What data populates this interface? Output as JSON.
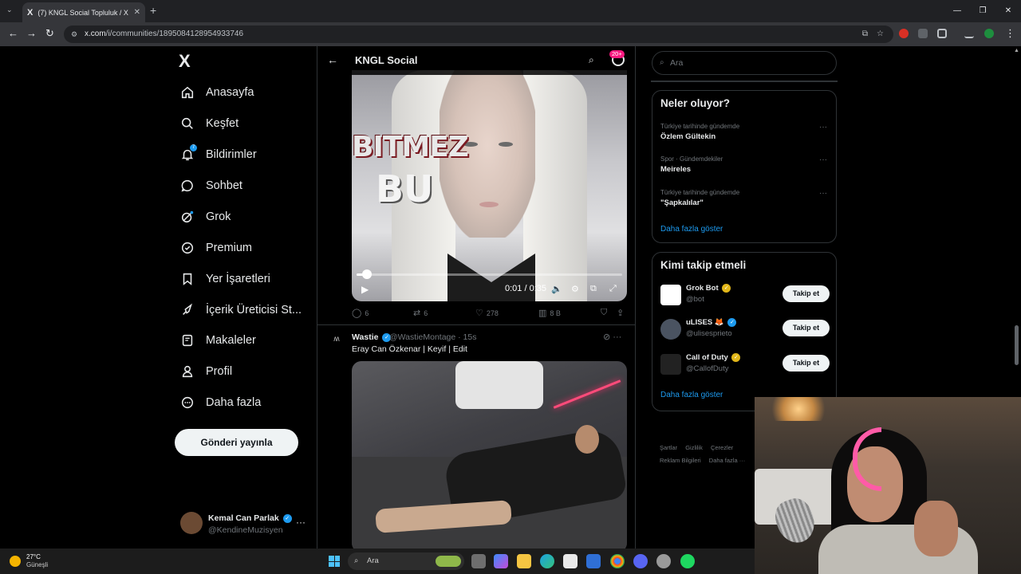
{
  "browser": {
    "tab_title": "(7) KNGL Social Topluluk / X",
    "tab_icon": "X",
    "url_host": "x.com",
    "url_path": "/i/communities/1895084128954933746"
  },
  "sidebar": {
    "logo": "X",
    "items": [
      {
        "label": "Anasayfa",
        "icon": "home-icon"
      },
      {
        "label": "Keşfet",
        "icon": "search-icon"
      },
      {
        "label": "Bildirimler",
        "icon": "bell-icon",
        "badge": "7"
      },
      {
        "label": "Sohbet",
        "icon": "chat-icon"
      },
      {
        "label": "Grok",
        "icon": "grok-icon"
      },
      {
        "label": "Premium",
        "icon": "verified-icon"
      },
      {
        "label": "Yer İşaretleri",
        "icon": "bookmark-icon"
      },
      {
        "label": "İçerik Üreticisi St...",
        "icon": "rocket-icon"
      },
      {
        "label": "Makaleler",
        "icon": "articles-icon"
      },
      {
        "label": "Profil",
        "icon": "person-icon"
      },
      {
        "label": "Daha fazla",
        "icon": "more-circle-icon"
      }
    ],
    "post_button": "Gönderi yayınla",
    "profile": {
      "name": "Kemal Can Parlak",
      "handle": "@KendineMuzisyen"
    }
  },
  "center": {
    "header_title": "KNGL Social",
    "notif_badge": "20+",
    "video1": {
      "overlay_text_1": "BITMEZ",
      "overlay_text_2": "BU",
      "time": "0:01 / 0:35",
      "progress": 0.03
    },
    "tweet1_actions": {
      "replies": "6",
      "reposts": "6",
      "likes": "278",
      "views": "8 B"
    },
    "tweet2": {
      "name": "Wastie",
      "handle": "@WastieMontage · 15s",
      "text": "Eray Can Özkenar | Keyif | Edit"
    }
  },
  "right": {
    "search_placeholder": "Ara",
    "trends_title": "Neler oluyor?",
    "trends": [
      {
        "category": "Türkiye tarihinde gündemde",
        "name": "Özlem Gültekin"
      },
      {
        "category": "Spor · Gündemdekiler",
        "name": "Meireles"
      },
      {
        "category": "Türkiye tarihinde gündemde",
        "name": "\"Şapkalılar\""
      }
    ],
    "show_more": "Daha fazla göster",
    "who_title": "Kimi takip etmeli",
    "who": [
      {
        "name": "Grok Bot",
        "handle": "@bot",
        "button": "Takip et"
      },
      {
        "name": "uLISES 🦊",
        "handle": "@ulisesprieto",
        "button": "Takip et"
      },
      {
        "name": "Call of Duty",
        "handle": "@CallofDuty",
        "button": "Takip et"
      }
    ],
    "who_show_more": "Daha fazla göster",
    "footer": [
      "Şartlar",
      "Gizlilik",
      "Çerezler",
      "Reklam Bilgileri",
      "Daha fazla ···"
    ]
  },
  "taskbar": {
    "temp": "27°C",
    "weather": "Güneşli",
    "search": "Ara"
  },
  "colors": {
    "accent": "#1d9bf0",
    "background": "#000000",
    "pink_badge": "#f91880"
  }
}
